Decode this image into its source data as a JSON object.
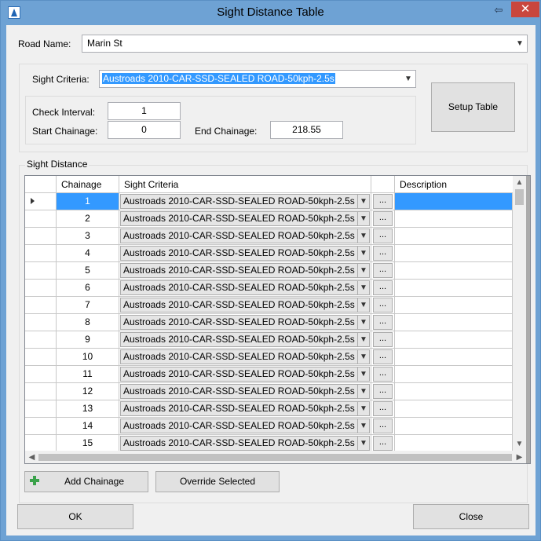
{
  "window": {
    "title": "Sight Distance Table",
    "restore_glyph": "⇦",
    "close_glyph": "✕"
  },
  "road": {
    "label": "Road Name:",
    "value": "Marin St"
  },
  "criteria": {
    "label": "Sight Criteria:",
    "value": "Austroads 2010-CAR-SSD-SEALED ROAD-50kph-2.5s"
  },
  "interval": {
    "check_label": "Check Interval:",
    "check_value": "1",
    "start_label": "Start Chainage:",
    "start_value": "0",
    "end_label": "End Chainage:",
    "end_value": "218.55"
  },
  "setup_button": "Setup Table",
  "sight_distance": {
    "group_label": "Sight Distance",
    "columns": [
      "Chainage",
      "Sight Criteria",
      "",
      "Description"
    ],
    "rows": [
      {
        "chainage": "1",
        "criteria": "Austroads 2010-CAR-SSD-SEALED ROAD-50kph-2.5s",
        "btn": "...",
        "description": ""
      },
      {
        "chainage": "2",
        "criteria": "Austroads 2010-CAR-SSD-SEALED ROAD-50kph-2.5s",
        "btn": "...",
        "description": ""
      },
      {
        "chainage": "3",
        "criteria": "Austroads 2010-CAR-SSD-SEALED ROAD-50kph-2.5s",
        "btn": "...",
        "description": ""
      },
      {
        "chainage": "4",
        "criteria": "Austroads 2010-CAR-SSD-SEALED ROAD-50kph-2.5s",
        "btn": "...",
        "description": ""
      },
      {
        "chainage": "5",
        "criteria": "Austroads 2010-CAR-SSD-SEALED ROAD-50kph-2.5s",
        "btn": "...",
        "description": ""
      },
      {
        "chainage": "6",
        "criteria": "Austroads 2010-CAR-SSD-SEALED ROAD-50kph-2.5s",
        "btn": "...",
        "description": ""
      },
      {
        "chainage": "7",
        "criteria": "Austroads 2010-CAR-SSD-SEALED ROAD-50kph-2.5s",
        "btn": "...",
        "description": ""
      },
      {
        "chainage": "8",
        "criteria": "Austroads 2010-CAR-SSD-SEALED ROAD-50kph-2.5s",
        "btn": "...",
        "description": ""
      },
      {
        "chainage": "9",
        "criteria": "Austroads 2010-CAR-SSD-SEALED ROAD-50kph-2.5s",
        "btn": "...",
        "description": ""
      },
      {
        "chainage": "10",
        "criteria": "Austroads 2010-CAR-SSD-SEALED ROAD-50kph-2.5s",
        "btn": "...",
        "description": ""
      },
      {
        "chainage": "11",
        "criteria": "Austroads 2010-CAR-SSD-SEALED ROAD-50kph-2.5s",
        "btn": "...",
        "description": ""
      },
      {
        "chainage": "12",
        "criteria": "Austroads 2010-CAR-SSD-SEALED ROAD-50kph-2.5s",
        "btn": "...",
        "description": ""
      },
      {
        "chainage": "13",
        "criteria": "Austroads 2010-CAR-SSD-SEALED ROAD-50kph-2.5s",
        "btn": "...",
        "description": ""
      },
      {
        "chainage": "14",
        "criteria": "Austroads 2010-CAR-SSD-SEALED ROAD-50kph-2.5s",
        "btn": "...",
        "description": ""
      },
      {
        "chainage": "15",
        "criteria": "Austroads 2010-CAR-SSD-SEALED ROAD-50kph-2.5s",
        "btn": "...",
        "description": ""
      }
    ],
    "selected_row": 0
  },
  "actions": {
    "add_chainage": "Add Chainage",
    "override_selected": "Override Selected"
  },
  "footer": {
    "ok": "OK",
    "close": "Close"
  },
  "icons": {
    "app": "app-logo-icon",
    "add": "plus-icon",
    "dropdown": "chevron-down-icon",
    "row_indicator": "row-pointer-icon"
  },
  "colors": {
    "title_bar": "#6ea2d4",
    "close_button": "#c9463d",
    "selection": "#3399ff",
    "add_icon": "#3aa24a"
  }
}
